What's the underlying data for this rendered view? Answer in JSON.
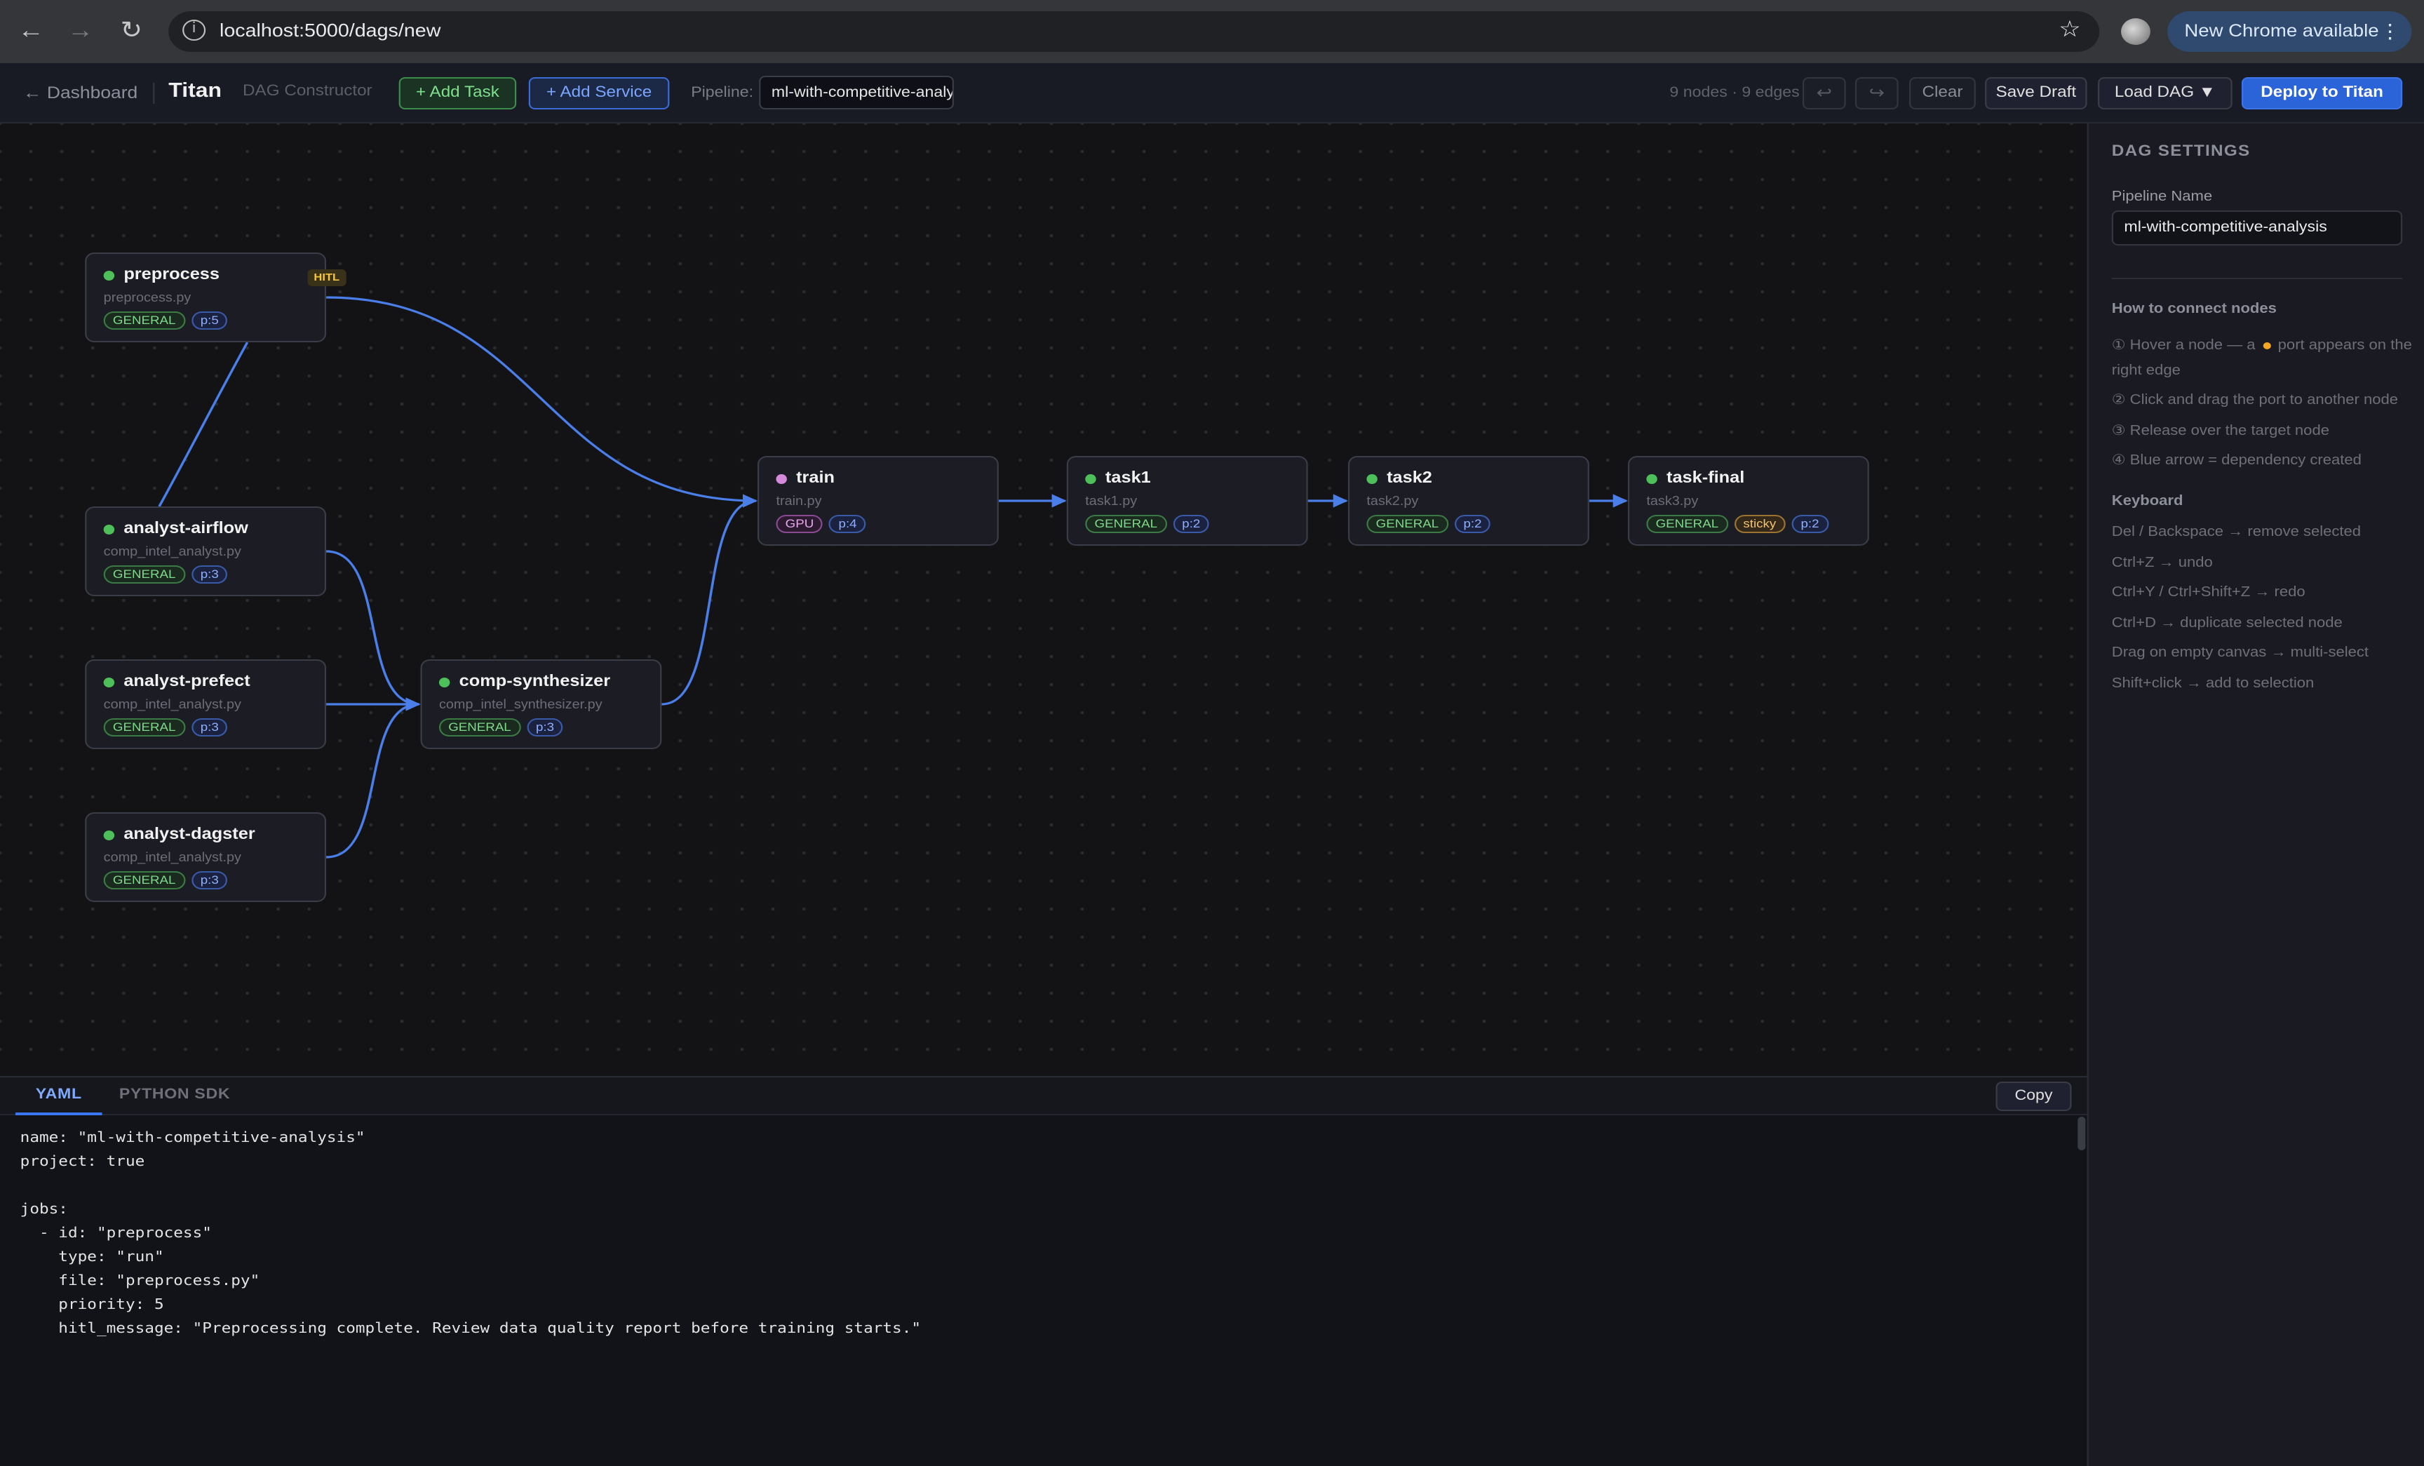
{
  "browser": {
    "url": "localhost:5000/dags/new",
    "update_label": "New Chrome available"
  },
  "header": {
    "back_label": "← Dashboard",
    "brand": "Titan",
    "subtitle": "DAG Constructor",
    "add_task_label": "+ Add Task",
    "add_service_label": "+ Add Service",
    "pipeline_label": "Pipeline:",
    "pipeline_value": "ml-with-competitive-analysis",
    "stats": "9 nodes · 9 edges",
    "undo_label": "↩",
    "redo_label": "↪",
    "clear_label": "Clear",
    "save_label": "Save Draft",
    "load_label": "Load DAG ▼",
    "deploy_label": "Deploy to Titan"
  },
  "nodes": [
    {
      "name": "preprocess",
      "file": "preprocess.py",
      "tags": [
        "GENERAL",
        "p:5"
      ],
      "badge": "HITL"
    },
    {
      "name": "analyst-airflow",
      "file": "comp_intel_analyst.py",
      "tags": [
        "GENERAL",
        "p:3"
      ]
    },
    {
      "name": "analyst-prefect",
      "file": "comp_intel_analyst.py",
      "tags": [
        "GENERAL",
        "p:3"
      ]
    },
    {
      "name": "analyst-dagster",
      "file": "comp_intel_analyst.py",
      "tags": [
        "GENERAL",
        "p:3"
      ]
    },
    {
      "name": "comp-synthesizer",
      "file": "comp_intel_synthesizer.py",
      "tags": [
        "GENERAL",
        "p:3"
      ]
    },
    {
      "name": "train",
      "file": "train.py",
      "tags": [
        "GPU",
        "p:4"
      ]
    },
    {
      "name": "task1",
      "file": "task1.py",
      "tags": [
        "GENERAL",
        "p:2"
      ]
    },
    {
      "name": "task2",
      "file": "task2.py",
      "tags": [
        "GENERAL",
        "p:2"
      ]
    },
    {
      "name": "task-final",
      "file": "task3.py",
      "tags": [
        "GENERAL",
        "sticky",
        "p:2"
      ]
    }
  ],
  "edges": [
    [
      "preprocess",
      "train"
    ],
    [
      "preprocess",
      "analyst-airflow"
    ],
    [
      "analyst-airflow",
      "comp-synthesizer"
    ],
    [
      "analyst-prefect",
      "comp-synthesizer"
    ],
    [
      "analyst-dagster",
      "comp-synthesizer"
    ],
    [
      "comp-synthesizer",
      "train"
    ],
    [
      "train",
      "task1"
    ],
    [
      "task1",
      "task2"
    ],
    [
      "task2",
      "task-final"
    ]
  ],
  "settings": {
    "title": "DAG SETTINGS",
    "pipeline_name_label": "Pipeline Name",
    "pipeline_name_value": "ml-with-competitive-analysis",
    "connect_heading": "How to connect nodes",
    "connect_step1_pre": "① Hover a node — a",
    "connect_step1_post": "port appears on the right edge",
    "connect_step2": "② Click and drag the port to another node",
    "connect_step3": "③ Release over the target node",
    "connect_step4": "④ Blue arrow = dependency created",
    "keyboard_heading": "Keyboard",
    "keyboard_lines": [
      "Del / Backspace → remove selected",
      "Ctrl+Z → undo",
      "Ctrl+Y / Ctrl+Shift+Z → redo",
      "Ctrl+D → duplicate selected node",
      "Drag on empty canvas → multi-select",
      "Shift+click → add to selection"
    ]
  },
  "code_panel": {
    "tab_yaml": "YAML",
    "tab_python": "PYTHON SDK",
    "copy_label": "Copy",
    "yaml_lines": [
      "name: \"ml-with-competitive-analysis\"",
      "project: true",
      "",
      "jobs:",
      "  - id: \"preprocess\"",
      "    type: \"run\"",
      "    file: \"preprocess.py\"",
      "    priority: 5",
      "    hitl_message: \"Preprocessing complete. Review data quality report before training starts.\""
    ]
  },
  "colors": {
    "edge": "#4a7ee8",
    "status_ok": "#4ec05a",
    "status_gpu": "#d48ad8",
    "accent": "#2b63d9"
  }
}
